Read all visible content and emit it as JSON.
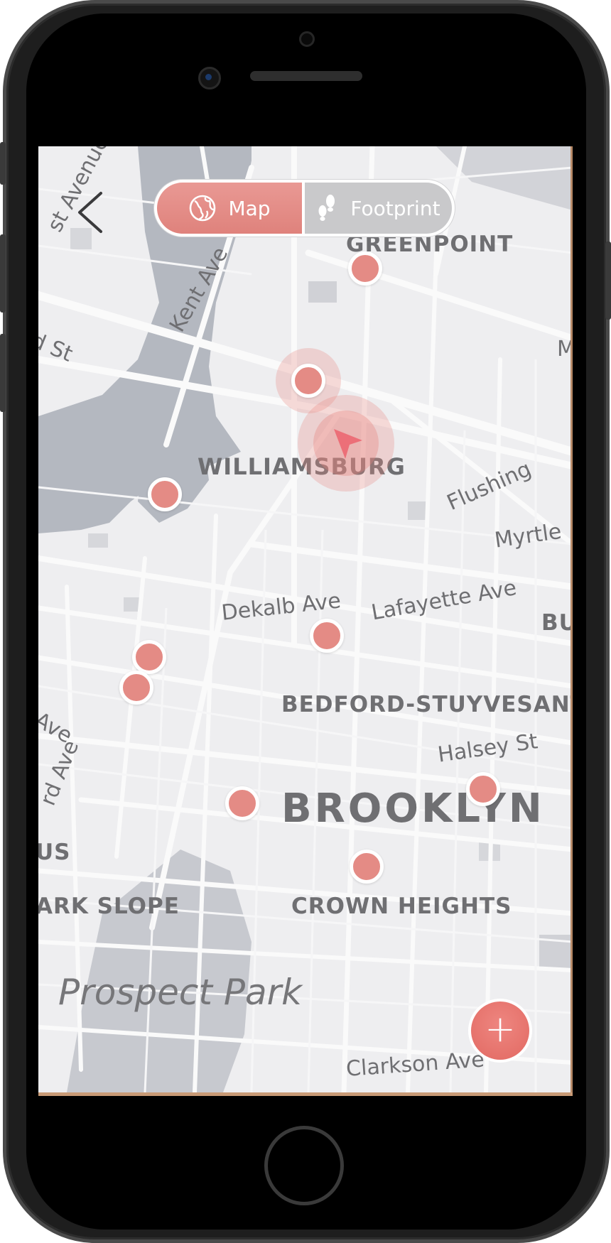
{
  "map": {
    "neighborhoods": {
      "greenpoint": "GREENPOINT",
      "williamsburg": "WILLIAMSBURG",
      "bedford": "BEDFORD-STUYVESANT",
      "brooklyn": "BROOKLYN",
      "crown_heights": "CROWN HEIGHTS",
      "park_slope": "ARK SLOPE",
      "bu": "BU",
      "us": "US",
      "prospect_park": "Prospect Park"
    },
    "streets": {
      "kent": "Kent Ave",
      "st_avenue": "st Avenue",
      "d_st": "d St",
      "flushing": "Flushing",
      "myrtle": "Myrtle",
      "dekalb": "Dekalb Ave",
      "lafayette": "Lafayette Ave",
      "halsey": "Halsey St",
      "ave": "Ave",
      "rd_ave": "rd Ave",
      "clarkson": "Clarkson Ave",
      "m": "M"
    }
  },
  "toggle": {
    "map_label": "Map",
    "footprint_label": "Footprint",
    "selected": "Map"
  },
  "fab": {
    "symbol": "+"
  },
  "colors": {
    "accent": "#e48b85",
    "toggle_inactive": "#c9c9cb",
    "map_background": "#eeeef0",
    "water": "#b4b8c0"
  },
  "icons": {
    "back": "chevron-left-icon",
    "map": "globe-icon",
    "footprint": "footprints-icon",
    "location": "location-arrow-icon",
    "add": "plus-icon"
  }
}
